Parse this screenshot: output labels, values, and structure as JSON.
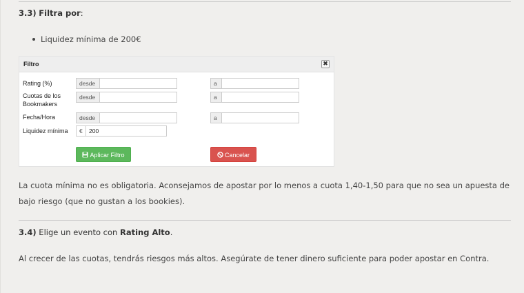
{
  "section_3_3": {
    "number": "3.3)",
    "title": "Filtra por",
    "suffix": ":",
    "bullets": [
      "Liquidez mínima de 200€"
    ]
  },
  "filter": {
    "title": "Filtro",
    "close_icon": "close-icon",
    "rows": [
      {
        "label": "Rating (%)",
        "from_addon": "desde",
        "from_value": "",
        "to_addon": "a",
        "to_value": ""
      },
      {
        "label": "Cuotas de los Bookmakers",
        "from_addon": "desde",
        "from_value": "",
        "to_addon": "a",
        "to_value": ""
      },
      {
        "label": "Fecha/Hora",
        "from_addon": "desde",
        "from_value": "",
        "to_addon": "a",
        "to_value": ""
      },
      {
        "label": "Liquidez mínima",
        "currency_addon": "€",
        "value": "200"
      }
    ],
    "apply_button": {
      "label": "Aplicar Filtro",
      "icon": "save-icon",
      "color": "#5cb85c"
    },
    "cancel_button": {
      "label": "Cancelar",
      "icon": "ban-icon",
      "color": "#d9534f"
    }
  },
  "paragraph_1": "La cuota mínima no es obligatoria. Aconsejamos de apostar por lo menos a cuota 1,40-1,50 para que no sea un apuesta de bajo riesgo (que no gustan a los bookies).",
  "section_3_4": {
    "number": "3.4)",
    "text": "Elige un evento con",
    "bold": "Rating Alto",
    "suffix": "."
  },
  "paragraph_2": "Al crecer de las cuotas, tendrás riesgos más altos. Asegúrate de tener dinero suficiente para poder apostar en Contra."
}
